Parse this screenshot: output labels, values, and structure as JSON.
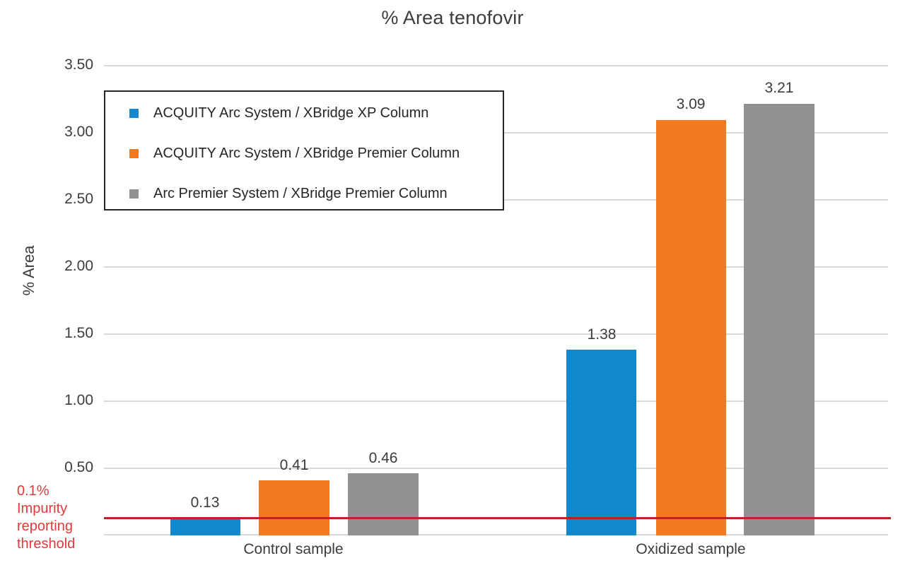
{
  "chart_data": {
    "type": "bar",
    "title": "% Area tenofovir",
    "xlabel": "",
    "ylabel": "% Area",
    "ylim": [
      0,
      3.5
    ],
    "ytick_labels": [
      "3.50",
      "3.00",
      "2.50",
      "2.00",
      "1.50",
      "1.00",
      "0.50"
    ],
    "ytick_values": [
      3.5,
      3.0,
      2.5,
      2.0,
      1.5,
      1.0,
      0.5
    ],
    "grid": true,
    "legend_position": "upper-left",
    "categories": [
      "Control sample",
      "Oxidized sample"
    ],
    "series": [
      {
        "name": "ACQUITY Arc System / XBridge XP Column",
        "color": "#1488ce",
        "values": [
          0.13,
          1.38
        ],
        "labels": [
          "0.13",
          "1.38"
        ]
      },
      {
        "name": "ACQUITY Arc System / XBridge Premier Column",
        "color": "#f2791f",
        "values": [
          0.41,
          3.09
        ],
        "labels": [
          "0.41",
          "3.09"
        ]
      },
      {
        "name": "Arc Premier System / XBridge Premier Column",
        "color": "#919194",
        "values": [
          0.46,
          3.21
        ],
        "labels": [
          "0.46",
          "3.21"
        ]
      }
    ],
    "annotations": [
      {
        "name": "impurity-reporting-threshold",
        "text": "0.1%\nImpurity\nreporting\nthreshold",
        "text_lines": [
          "0.1%",
          "Impurity",
          "reporting",
          "threshold"
        ],
        "value": 0.1,
        "color": "#e03a3a",
        "line_color": "#c0202a"
      }
    ]
  },
  "threshold": {
    "line1": "0.1%",
    "line2": "Impurity",
    "line3": "reporting",
    "line4": "threshold"
  }
}
